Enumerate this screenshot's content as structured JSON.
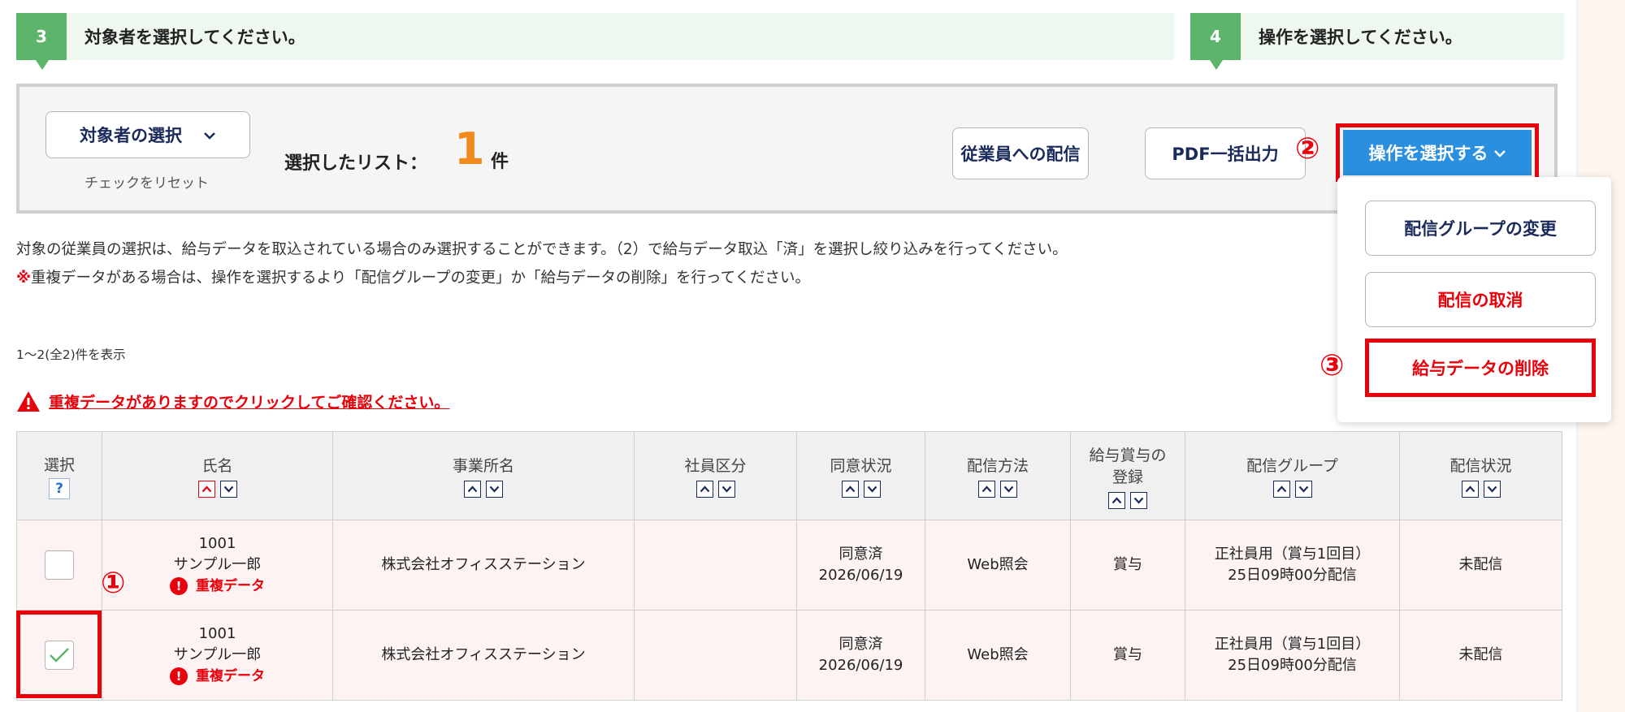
{
  "steps": [
    {
      "num": "3",
      "text": "対象者を選択してください。"
    },
    {
      "num": "4",
      "text": "操作を選択してください。"
    }
  ],
  "panel": {
    "select_target_label": "対象者の選択",
    "reset_label": "チェックをリセット",
    "list_label": "選択したリスト：",
    "count": "1",
    "count_unit": "件",
    "deliver_button": "従業員への配信",
    "pdf_button": "PDF一括出力",
    "operation_button": "操作を選択する"
  },
  "dropdown": {
    "items": [
      "配信グループの変更",
      "配信の取消",
      "給与データの削除"
    ]
  },
  "markers": [
    "①",
    "②",
    "③"
  ],
  "notices": {
    "line1": "対象の従業員の選択は、給与データを取込されている場合のみ選択することができます。（2）で給与データ取込「済」を選択し絞り込みを行ってください。",
    "line2_mark": "※",
    "line2": "重複データがある場合は、操作を選択するより「配信グループの変更」か「給与データの削除」を行ってください。"
  },
  "range_text": "1〜2(全2)件を表示",
  "duplicate_warning": "重複データがありますのでクリックしてご確認ください。",
  "table": {
    "headers": {
      "select": "選択",
      "help": "?",
      "name": "氏名",
      "office": "事業所名",
      "emp_type": "社員区分",
      "consent": "同意状況",
      "method": "配信方法",
      "registration_line1": "給与賞与の",
      "registration_line2": "登録",
      "group": "配信グループ",
      "status": "配信状況"
    },
    "rows": [
      {
        "checked": false,
        "emp_id": "1001",
        "name": "サンプル一郎",
        "dup_label": "重複データ",
        "office": "株式会社オフィスステーション",
        "emp_type": "",
        "consent": "同意済",
        "consent_date": "2026/06/19",
        "method": "Web照会",
        "registration": "賞与",
        "group": "正社員用（賞与1回目）",
        "group_schedule": "25日09時00分配信",
        "status": "未配信"
      },
      {
        "checked": true,
        "emp_id": "1001",
        "name": "サンプル一郎",
        "dup_label": "重複データ",
        "office": "株式会社オフィスステーション",
        "emp_type": "",
        "consent": "同意済",
        "consent_date": "2026/06/19",
        "method": "Web照会",
        "registration": "賞与",
        "group": "正社員用（賞与1回目）",
        "group_schedule": "25日09時00分配信",
        "status": "未配信"
      }
    ]
  },
  "colors": {
    "step_green": "#5cb56a",
    "accent_blue": "#2a8fde",
    "alert_red": "#e8000b",
    "count_orange": "#f08a1c"
  }
}
